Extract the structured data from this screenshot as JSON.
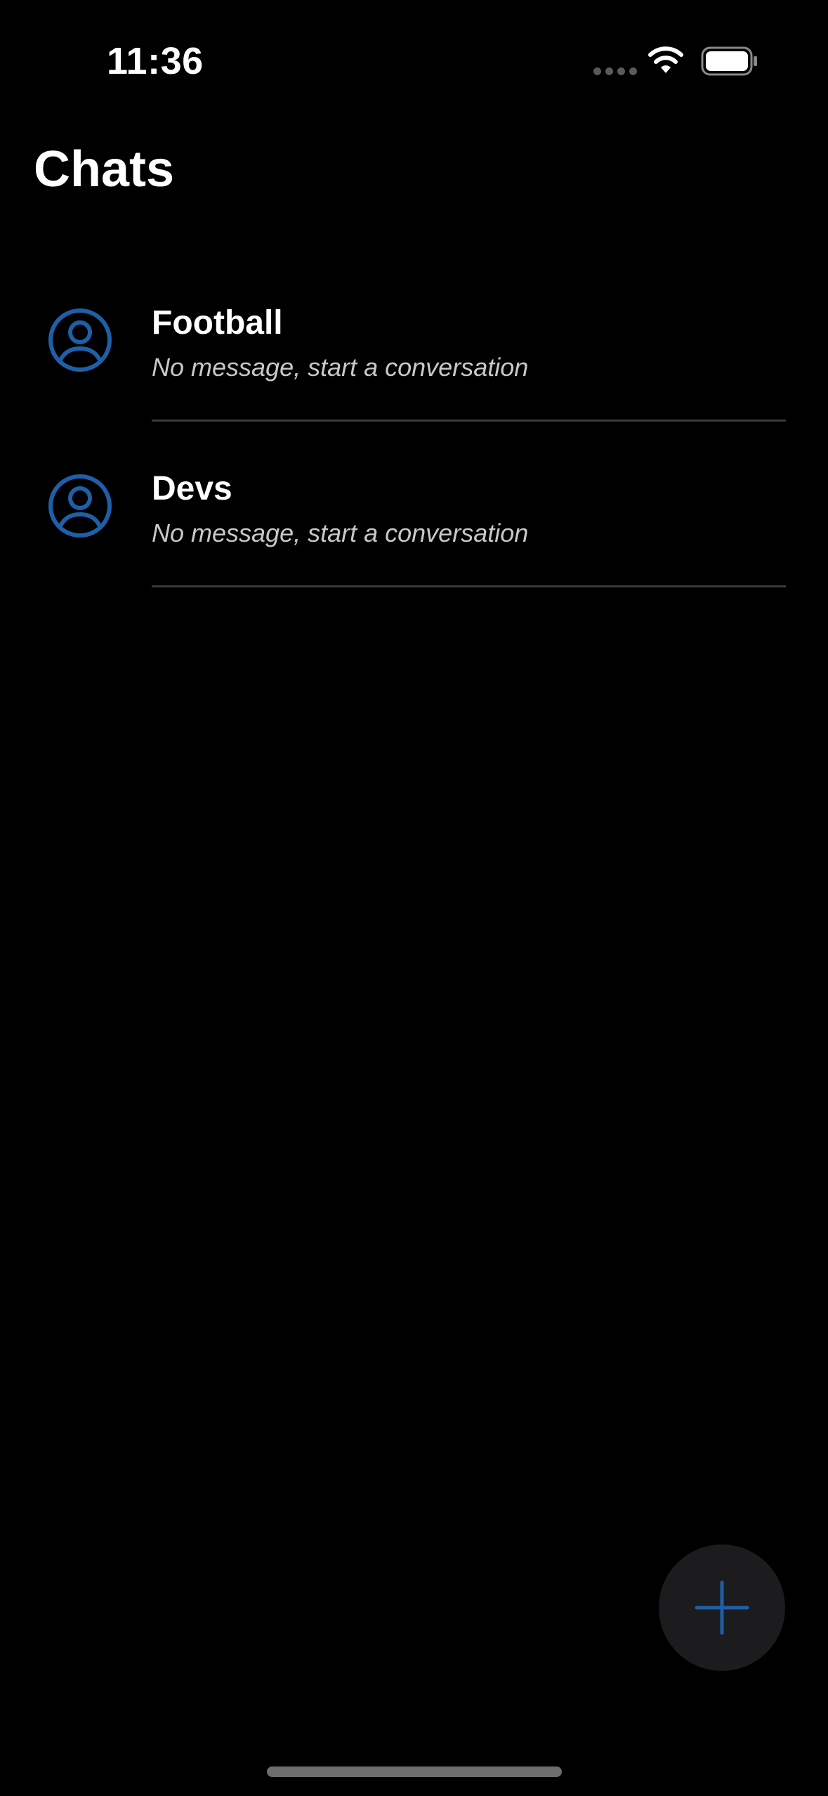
{
  "status_bar": {
    "time": "11:36"
  },
  "header": {
    "title": "Chats"
  },
  "chats": [
    {
      "name": "Football",
      "preview": "No message, start a conversation",
      "avatar_icon": "user-circle-icon"
    },
    {
      "name": "Devs",
      "preview": "No message, start a conversation",
      "avatar_icon": "user-circle-icon"
    }
  ],
  "fab": {
    "icon": "plus-icon"
  },
  "colors": {
    "background": "#000000",
    "accent": "#1f5fa8",
    "text_primary": "#ffffff",
    "text_secondary": "#c8c8c8",
    "divider": "#3a3a3a",
    "fab_background": "#1c1c1e"
  }
}
